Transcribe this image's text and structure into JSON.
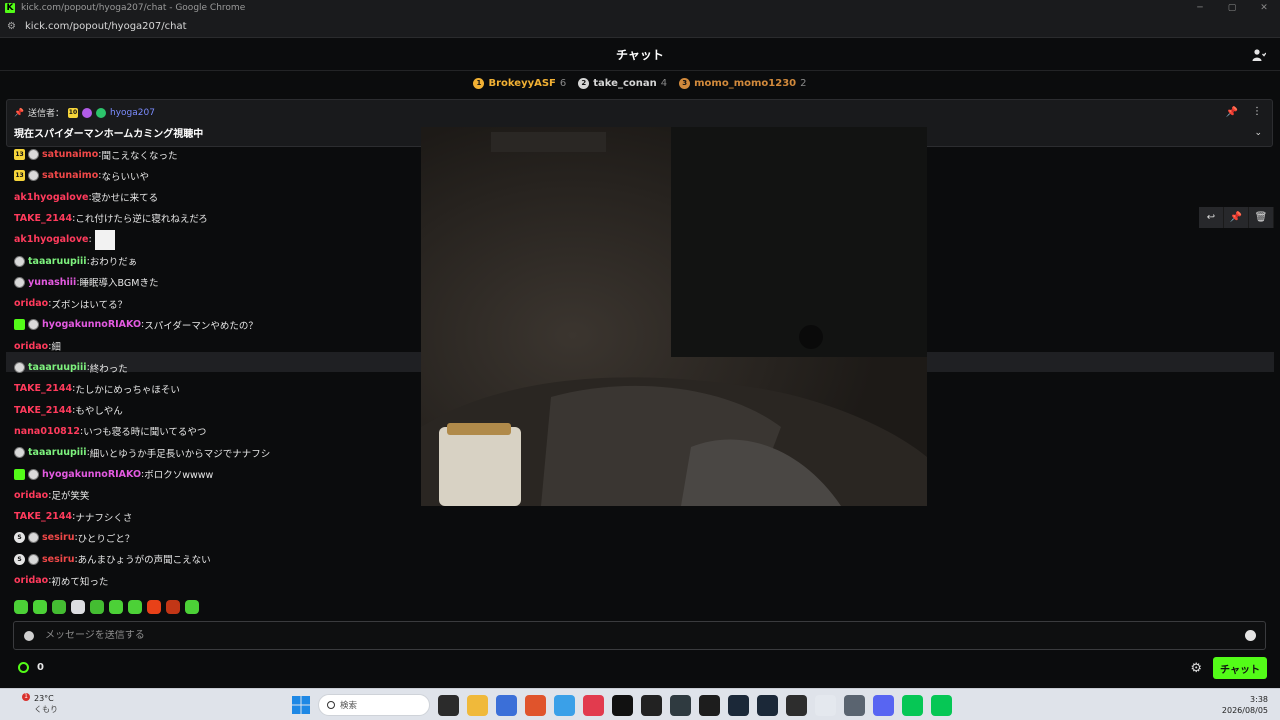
{
  "window": {
    "title": "kick.com/popout/hyoga207/chat - Google Chrome",
    "url": "kick.com/popout/hyoga207/chat",
    "favicon": "K"
  },
  "chat_header": {
    "title": "チャット"
  },
  "leaderboard": [
    {
      "rank": "1",
      "name": "BrokeyyASF",
      "count": "6",
      "color": "#f2b134"
    },
    {
      "rank": "2",
      "name": "take_conan",
      "count": "4",
      "color": "#d6d6d6"
    },
    {
      "rank": "3",
      "name": "momo_momo1230",
      "count": "2",
      "color": "#d28a3c"
    }
  ],
  "pinned": {
    "sender_label": "送信者：",
    "badge_num": "10",
    "username": "hyoga207",
    "text": "現在スパイダーマンホームカミング視聴中"
  },
  "messages": [
    {
      "badges": [
        "sub13",
        "gif"
      ],
      "user": "satunaimo",
      "color": "#f04848",
      "text": "聞こえなくなった"
    },
    {
      "badges": [
        "sub13",
        "gif"
      ],
      "user": "satunaimo",
      "color": "#f04848",
      "text": "ならいいや"
    },
    {
      "badges": [],
      "user": "ak1hyogalove",
      "color": "#ff3b5c",
      "text": "寝かせに来てる"
    },
    {
      "badges": [],
      "user": "TAKE_2144",
      "color": "#ff3b5c",
      "text": "これ付けたら逆に寝れねえだろ"
    },
    {
      "badges": [],
      "user": "ak1hyogalove",
      "color": "#ff3b5c",
      "text": "",
      "emote": true
    },
    {
      "badges": [
        "gif"
      ],
      "user": "taaaruupiii",
      "color": "#7ef27e",
      "text": "おわりだぁ"
    },
    {
      "badges": [
        "gif"
      ],
      "user": "yunashiii",
      "color": "#e35ae0",
      "text": "睡眠導入BGMきた"
    },
    {
      "badges": [],
      "user": "oridao",
      "color": "#ff3b5c",
      "text": "ズボンはいてる？"
    },
    {
      "badges": [
        "gift",
        "gif"
      ],
      "user": "hyogakunnoRIAKO",
      "color": "#e35ae0",
      "text": "スパイダーマンやめたの？"
    },
    {
      "badges": [],
      "user": "oridao",
      "color": "#ff3b5c",
      "text": "細"
    },
    {
      "badges": [
        "gif"
      ],
      "user": "taaaruupiii",
      "color": "#7ef27e",
      "text": "終わった"
    },
    {
      "badges": [],
      "user": "TAKE_2144",
      "color": "#ff3b5c",
      "text": "たしかにめっちゃほそい"
    },
    {
      "badges": [],
      "user": "TAKE_2144",
      "color": "#ff3b5c",
      "text": "もやしやん"
    },
    {
      "badges": [],
      "user": "nana010812",
      "color": "#ff3b5c",
      "text": "いつも寝る時に聞いてるやつ"
    },
    {
      "badges": [
        "gif"
      ],
      "user": "taaaruupiii",
      "color": "#7ef27e",
      "text": "細いとゆうか手足長いからマジでナナフシ"
    },
    {
      "badges": [
        "gift",
        "gif"
      ],
      "user": "hyogakunnoRIAKO",
      "color": "#e35ae0",
      "text": "ボロクソwwww"
    },
    {
      "badges": [],
      "user": "oridao",
      "color": "#ff3b5c",
      "text": "足が笑笑"
    },
    {
      "badges": [],
      "user": "TAKE_2144",
      "color": "#ff3b5c",
      "text": "ナナフシくさ"
    },
    {
      "badges": [
        "s",
        "gif"
      ],
      "user": "sesiru",
      "color": "#f04848",
      "text": "ひとりごと？"
    },
    {
      "badges": [
        "s",
        "gif"
      ],
      "user": "sesiru",
      "color": "#f04848",
      "text": "あんまひょうがの声聞こえない"
    },
    {
      "badges": [],
      "user": "oridao",
      "color": "#ff3b5c",
      "text": "初めて知った"
    }
  ],
  "emote_colors": [
    "#4cd137",
    "#4cd137",
    "#44bd32",
    "#dcdde1",
    "#44bd32",
    "#4cd137",
    "#4cd137",
    "#e84118",
    "#c23616",
    "#4cd137"
  ],
  "input": {
    "placeholder": "メッセージを送信する",
    "value": ""
  },
  "points": {
    "value": "0"
  },
  "send_button": {
    "label": "チャット"
  },
  "taskbar": {
    "temperature": "23°C",
    "condition": "くもり",
    "weather_badge": "1",
    "search_placeholder": "検索",
    "time": "3:38",
    "date": "2026/08/05",
    "app_colors": [
      "#2b2b2b",
      "#f0b93a",
      "#3b6fd8",
      "#e0542c",
      "#3aa0e8",
      "#e23b4e",
      "#111111",
      "#222222",
      "#2f3a40",
      "#1d1d1d",
      "#1b2838",
      "#1b2838",
      "#2d2d2d",
      "#e4e8ee",
      "#5a6470",
      "#5865f2",
      "#06c755",
      "#06c755"
    ]
  }
}
